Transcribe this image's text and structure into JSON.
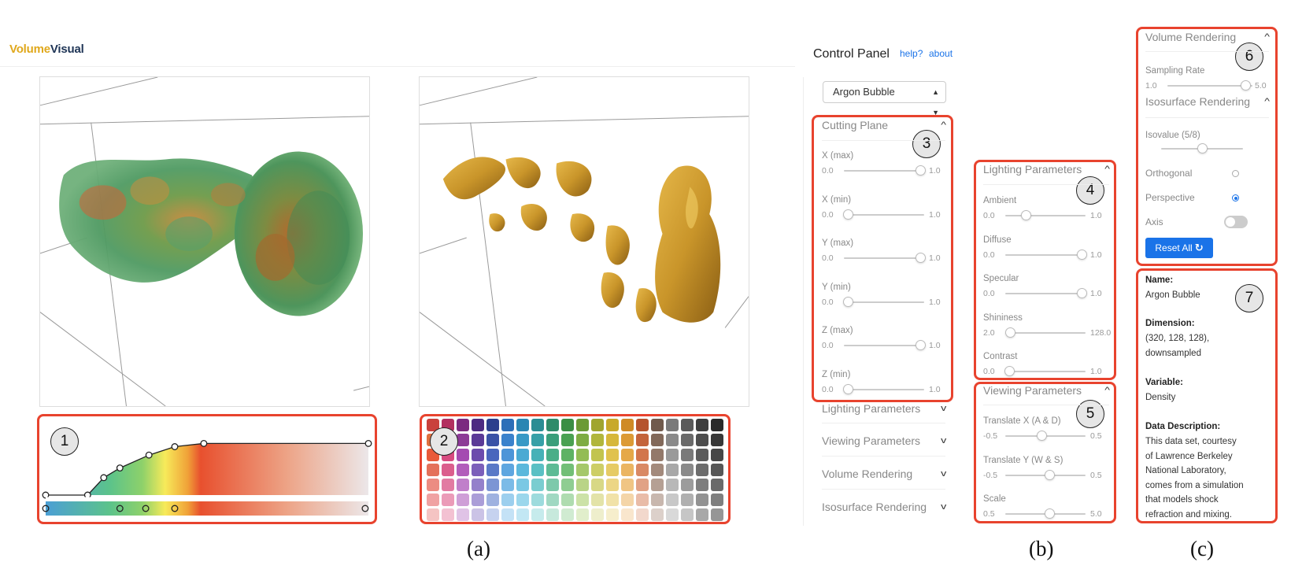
{
  "logo": {
    "part1": "Volume",
    "part2": "Visual"
  },
  "control_panel": {
    "title": "Control Panel",
    "help_link": "help?",
    "about_link": "about",
    "dataset": "Argon Bubble",
    "collapsed_sections": [
      "Lighting Parameters",
      "Viewing Parameters",
      "Volume Rendering",
      "Isosurface Rendering"
    ]
  },
  "cutting_plane": {
    "title": "Cutting Plane",
    "sliders": [
      {
        "label": "X (max)",
        "min": "0.0",
        "max": "1.0",
        "value": 0.95
      },
      {
        "label": "X (min)",
        "min": "0.0",
        "max": "1.0",
        "value": 0.05
      },
      {
        "label": "Y (max)",
        "min": "0.0",
        "max": "1.0",
        "value": 0.95
      },
      {
        "label": "Y (min)",
        "min": "0.0",
        "max": "1.0",
        "value": 0.05
      },
      {
        "label": "Z (max)",
        "min": "0.0",
        "max": "1.0",
        "value": 0.95
      },
      {
        "label": "Z (min)",
        "min": "0.0",
        "max": "1.0",
        "value": 0.05
      }
    ]
  },
  "lighting": {
    "title": "Lighting Parameters",
    "sliders": [
      {
        "label": "Ambient",
        "min": "0.0",
        "max": "1.0",
        "value": 0.25
      },
      {
        "label": "Diffuse",
        "min": "0.0",
        "max": "1.0",
        "value": 0.95
      },
      {
        "label": "Specular",
        "min": "0.0",
        "max": "1.0",
        "value": 0.95
      },
      {
        "label": "Shininess",
        "min": "2.0",
        "max": "128.0",
        "value": 0.06
      },
      {
        "label": "Contrast",
        "min": "0.0",
        "max": "1.0",
        "value": 0.05
      }
    ]
  },
  "viewing": {
    "title": "Viewing Parameters",
    "sliders": [
      {
        "label": "Translate X (A & D)",
        "min": "-0.5",
        "max": "0.5",
        "value": 0.45
      },
      {
        "label": "Translate Y (W & S)",
        "min": "-0.5",
        "max": "0.5",
        "value": 0.55
      },
      {
        "label": "Scale",
        "min": "0.5",
        "max": "5.0",
        "value": 0.55
      }
    ]
  },
  "volume_rendering": {
    "title": "Volume Rendering",
    "sampling_label": "Sampling Rate",
    "sampling_min": "1.0",
    "sampling_max": "5.0",
    "sampling_value": 0.92
  },
  "isosurface": {
    "title": "Isosurface Rendering",
    "isovalue_label": "Isovalue (5/8)",
    "isovalue_fraction": 0.5,
    "orthogonal_label": "Orthogonal",
    "perspective_label": "Perspective",
    "axis_label": "Axis",
    "projection": "Perspective",
    "axis_on": false,
    "reset_label": "Reset All"
  },
  "info": {
    "name_label": "Name:",
    "name_value": "Argon Bubble",
    "dimension_label": "Dimension:",
    "dimension_value": "(320, 128, 128), downsampled",
    "variable_label": "Variable:",
    "variable_value": "Density",
    "description_label": "Data Description:",
    "description_value": "This data set, courtesy of Lawrence Berkeley National Laboratory, comes from a simulation that models shock refraction and mixing."
  },
  "badges": [
    "1",
    "2",
    "3",
    "4",
    "5",
    "6",
    "7"
  ],
  "figure_labels": [
    "(a)",
    "(b)",
    "(c)"
  ],
  "transfer_function": {
    "opacity_points": [
      [
        0.0,
        0.0
      ],
      [
        0.13,
        0.0
      ],
      [
        0.18,
        0.27
      ],
      [
        0.23,
        0.42
      ],
      [
        0.32,
        0.62
      ],
      [
        0.4,
        0.75
      ],
      [
        0.49,
        0.8
      ],
      [
        1.0,
        0.8
      ]
    ],
    "color_stops": [
      {
        "pos": 0.0,
        "color": "#4b9fd5"
      },
      {
        "pos": 0.2,
        "color": "#5cc38a"
      },
      {
        "pos": 0.3,
        "color": "#8ed16a"
      },
      {
        "pos": 0.37,
        "color": "#f7ea5a"
      },
      {
        "pos": 0.44,
        "color": "#f0a238"
      },
      {
        "pos": 0.48,
        "color": "#e8502e"
      },
      {
        "pos": 0.75,
        "color": "#eda487"
      },
      {
        "pos": 1.0,
        "color": "#ece7e9"
      }
    ],
    "color_points": [
      0.0,
      0.23,
      0.31,
      0.4,
      0.99
    ]
  },
  "palette_columns": [
    [
      "#c9413c",
      "#e0703f",
      "#e85a3a",
      "#e4715a",
      "#ec8c82",
      "#f0a2a2",
      "#f5c4c3"
    ],
    [
      "#b23060",
      "#c43b74",
      "#d74b80",
      "#db5e8d",
      "#e27ba2",
      "#eb9bb8",
      "#f3c1d2"
    ],
    [
      "#7b2a80",
      "#8d3a97",
      "#a44bb1",
      "#b25dbb",
      "#c07fca",
      "#cf9fd7",
      "#e0c3e6"
    ],
    [
      "#4d2b82",
      "#5b3a97",
      "#6c4bad",
      "#7c5fba",
      "#9480cb",
      "#ab9ed8",
      "#cbc3e6"
    ],
    [
      "#2c3f8d",
      "#3a52a6",
      "#4a66bd",
      "#5a79c7",
      "#7c95d4",
      "#9fb2e0",
      "#c6d2ef"
    ],
    [
      "#2d6fb8",
      "#3a82cc",
      "#4d95d8",
      "#5ea6e0",
      "#7bbbe7",
      "#9ccfee",
      "#c4e2f6"
    ],
    [
      "#2a86b3",
      "#3799c6",
      "#4aaad3",
      "#5bb8dc",
      "#7ac8e4",
      "#9bd7ec",
      "#c2e7f4"
    ],
    [
      "#2a8d94",
      "#36a0a7",
      "#47b1b7",
      "#5ac0c4",
      "#7acdd0",
      "#9ddbdd",
      "#c6ebec"
    ],
    [
      "#2e8b6a",
      "#3a9e7a",
      "#4aae88",
      "#5dbb95",
      "#7dc9ab",
      "#a0d8c2",
      "#c7e9dc"
    ],
    [
      "#3a8e44",
      "#4aa152",
      "#5eb264",
      "#72bf77",
      "#8fcd92",
      "#afdcb0",
      "#d0ebd1"
    ],
    [
      "#6b9a35",
      "#7eac43",
      "#93bc55",
      "#a5c86a",
      "#b9d487",
      "#cce2a7",
      "#e1eecb"
    ],
    [
      "#a0a52f",
      "#b1b63c",
      "#c2c44f",
      "#cdce66",
      "#d8d886",
      "#e3e3a8",
      "#eeeecc"
    ],
    [
      "#c8a92a",
      "#d6b73a",
      "#e0c24e",
      "#e6cb65",
      "#ecd685",
      "#f1e2a8",
      "#f6eecc"
    ],
    [
      "#cf8a26",
      "#dc9a35",
      "#e5a848",
      "#ebb562",
      "#f0c584",
      "#f4d5a8",
      "#f9e6cd"
    ],
    [
      "#b5542e",
      "#c4643b",
      "#d2764c",
      "#d98964",
      "#e1a285",
      "#e9bca8",
      "#f2d8cc"
    ],
    [
      "#705a4c",
      "#82695a",
      "#93796a",
      "#a38a7c",
      "#b5a094",
      "#c8b7ae",
      "#dcd0ca"
    ],
    [
      "#7a7a7a",
      "#8a8a8a",
      "#9a9a9a",
      "#a8a8a8",
      "#b8b8b8",
      "#c8c8c8",
      "#d9d9d9"
    ],
    [
      "#5a5a5a",
      "#6a6a6a",
      "#7a7a7a",
      "#8a8a8a",
      "#9c9c9c",
      "#b0b0b0",
      "#c6c6c6"
    ],
    [
      "#3e3e3e",
      "#4d4d4d",
      "#5c5c5c",
      "#6c6c6c",
      "#7e7e7e",
      "#929292",
      "#a8a8a8"
    ],
    [
      "#2a2a2a",
      "#383838",
      "#474747",
      "#575757",
      "#6a6a6a",
      "#7f7f7f",
      "#969696"
    ]
  ]
}
